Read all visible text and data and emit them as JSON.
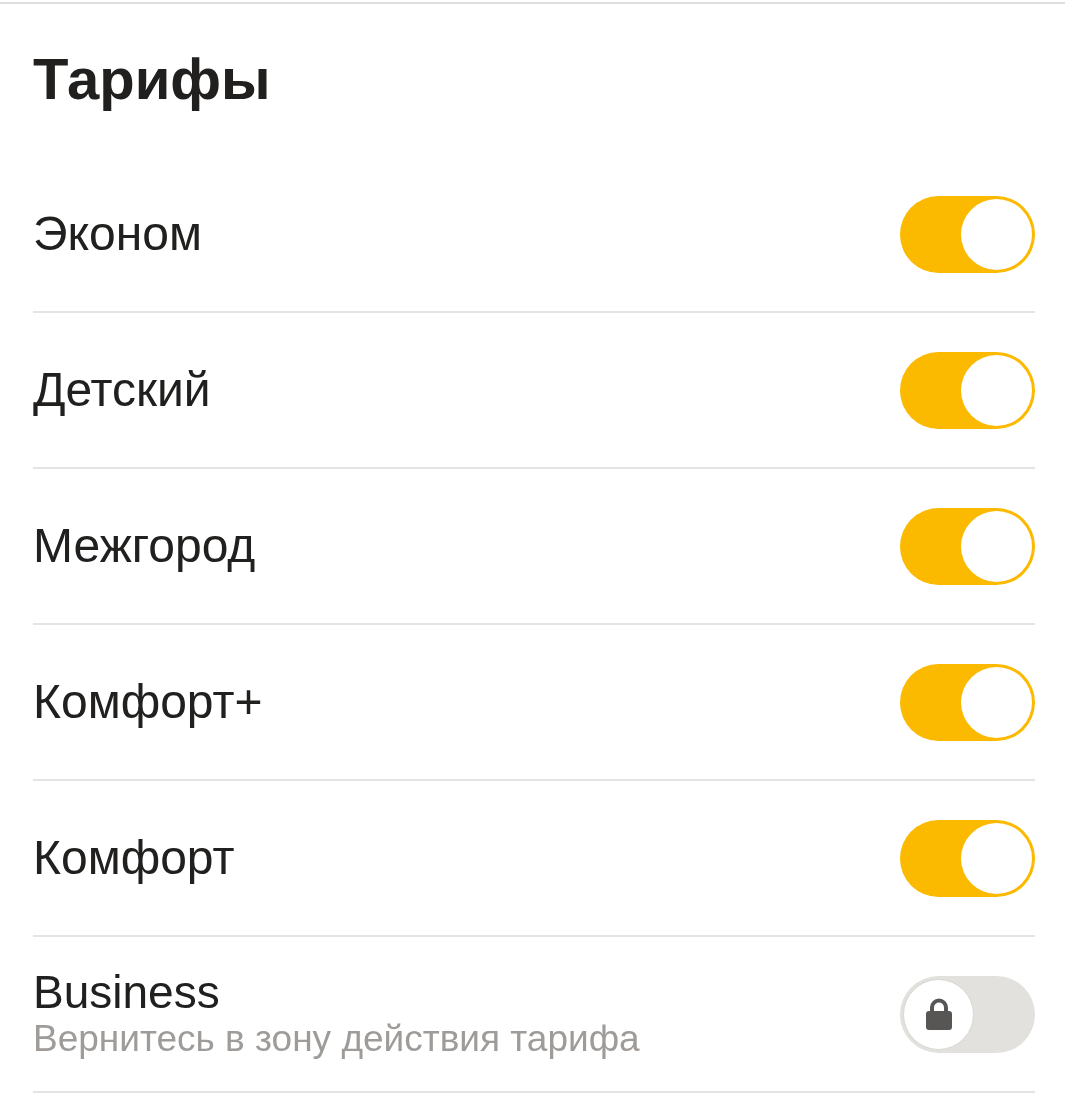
{
  "title": "Тарифы",
  "rows": [
    {
      "name": "Эконом",
      "on": true,
      "locked": false
    },
    {
      "name": "Детский",
      "on": true,
      "locked": false
    },
    {
      "name": "Межгород",
      "on": true,
      "locked": false
    },
    {
      "name": "Комфорт+",
      "on": true,
      "locked": false
    },
    {
      "name": "Комфорт",
      "on": true,
      "locked": false
    },
    {
      "name": "Business",
      "note": "Вернитесь в зону действия тарифа",
      "on": false,
      "locked": true
    }
  ]
}
